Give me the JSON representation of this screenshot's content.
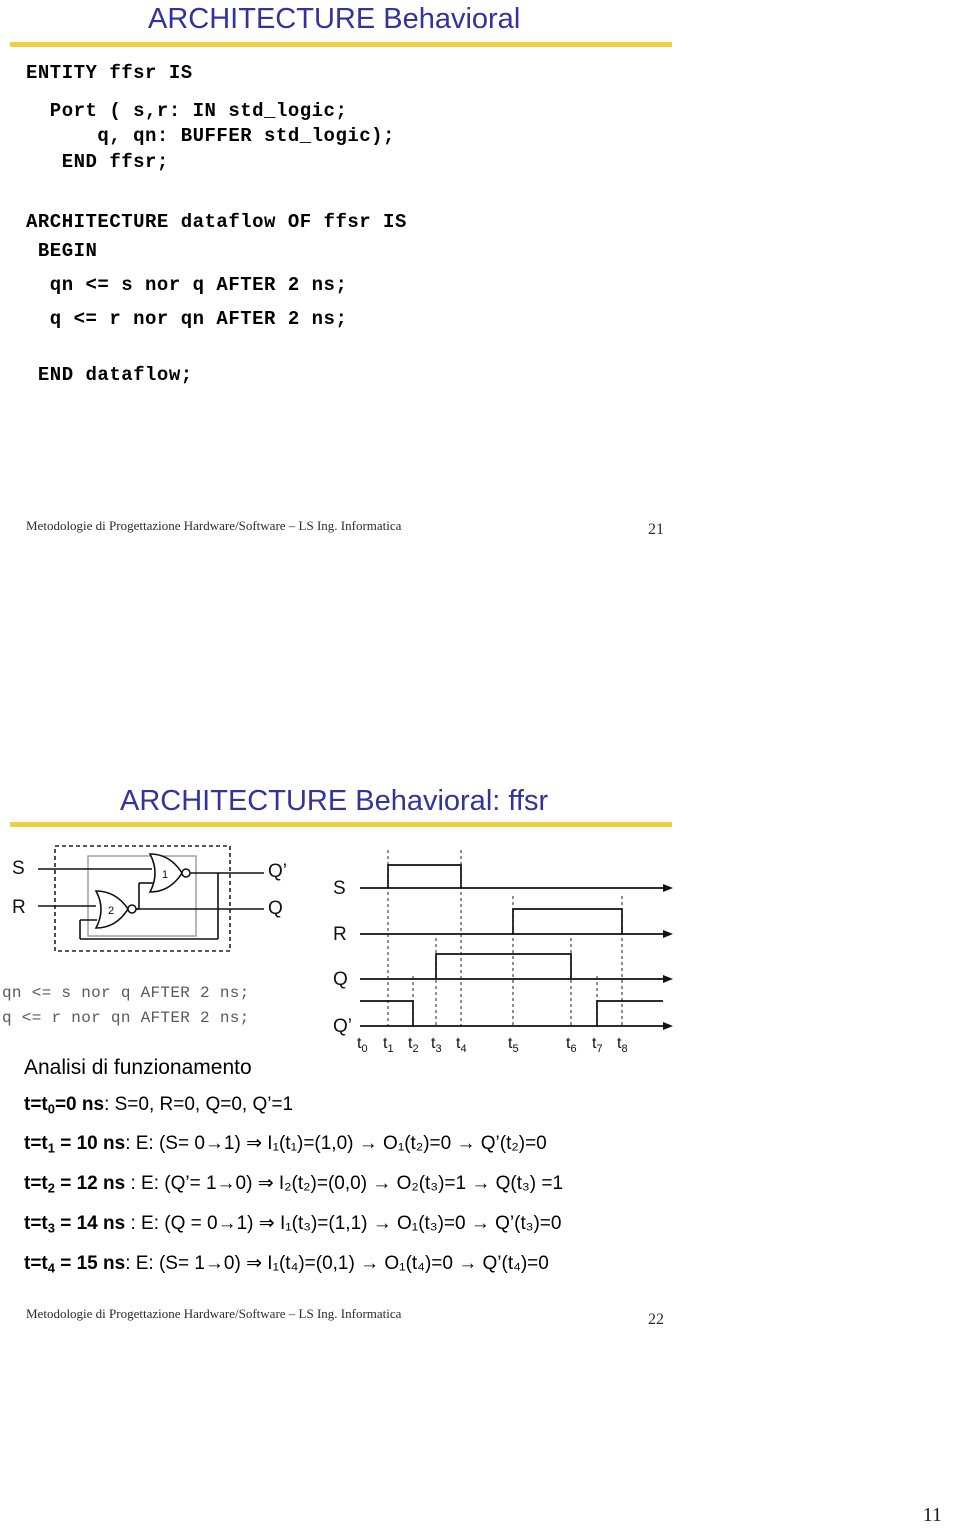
{
  "slide1": {
    "title": "ARCHITECTURE Behavioral",
    "code_lines": [
      "ENTITY ffsr IS",
      "  Port ( s,r: IN std_logic;",
      "      q, qn: BUFFER std_logic);",
      "   END ffsr;",
      "",
      "ARCHITECTURE dataflow OF ffsr IS",
      " BEGIN",
      "  qn <= s nor q AFTER 2 ns;",
      "  q <= r nor qn AFTER 2 ns;",
      "",
      " END dataflow;"
    ],
    "footer": "Metodologie di Progettazione Hardware/Software – LS Ing. Informatica",
    "page": "21"
  },
  "slide2": {
    "title": "ARCHITECTURE Behavioral: ffsr",
    "circuit": {
      "input_s": "S",
      "input_r": "R",
      "output_qn": "Q’",
      "output_q": "Q",
      "gate1_label": "1",
      "gate2_label": "2"
    },
    "code_overlay": [
      "qn <= s nor q AFTER 2 ns;",
      "q <= r nor qn AFTER 2 ns;"
    ],
    "timing": {
      "signal_labels": [
        "S",
        "R",
        "Q",
        "Q’"
      ],
      "time_labels": [
        "t",
        "t",
        "t",
        "t",
        "t",
        "t",
        "t",
        "t",
        "t"
      ],
      "time_subs": [
        "0",
        "1",
        "2",
        "3",
        "4",
        "5",
        "6",
        "7",
        "8"
      ]
    },
    "analysis_heading": "Analisi di funzionamento",
    "analysis_lines": [
      {
        "lead": "t=t",
        "lead_sub": "0",
        "lead_tail": "=0 ns",
        "rest": ": S=0, R=0, Q=0, Q’=1"
      },
      {
        "lead": "t=t",
        "lead_sub": "1",
        "lead_tail": " = 10 ns",
        "rest": ": E: (S= 0→1) ⇒   I₁(t₁)=(1,0) → O₁(t₂)=0 → Q’(t₂)=0"
      },
      {
        "lead": "t=t",
        "lead_sub": "2",
        "lead_tail": " = 12 ns",
        "rest": " : E:     (Q’= 1→0) ⇒   I₂(t₂)=(0,0) → O₂(t₃)=1 → Q(t₃) =1"
      },
      {
        "lead": "t=t",
        "lead_sub": "3",
        "lead_tail": " = 14 ns",
        "rest": " : E:     (Q = 0→1) ⇒  I₁(t₃)=(1,1) → O₁(t₃)=0 → Q’(t₃)=0"
      },
      {
        "lead": "t=t",
        "lead_sub": "4",
        "lead_tail": " = 15 ns",
        "rest": ": E: (S= 1→0) ⇒   I₁(t₄)=(0,1) → O₁(t₄)=0 → Q’(t₄)=0"
      }
    ],
    "footer": "Metodologie di Progettazione Hardware/Software – LS Ing. Informatica",
    "page": "22"
  },
  "document_page_number": "11",
  "colors": {
    "title_blue": "#33339c",
    "rule_yellow": "#f0d040",
    "ink": "#000000",
    "grey_code": "#5a5a5a"
  }
}
